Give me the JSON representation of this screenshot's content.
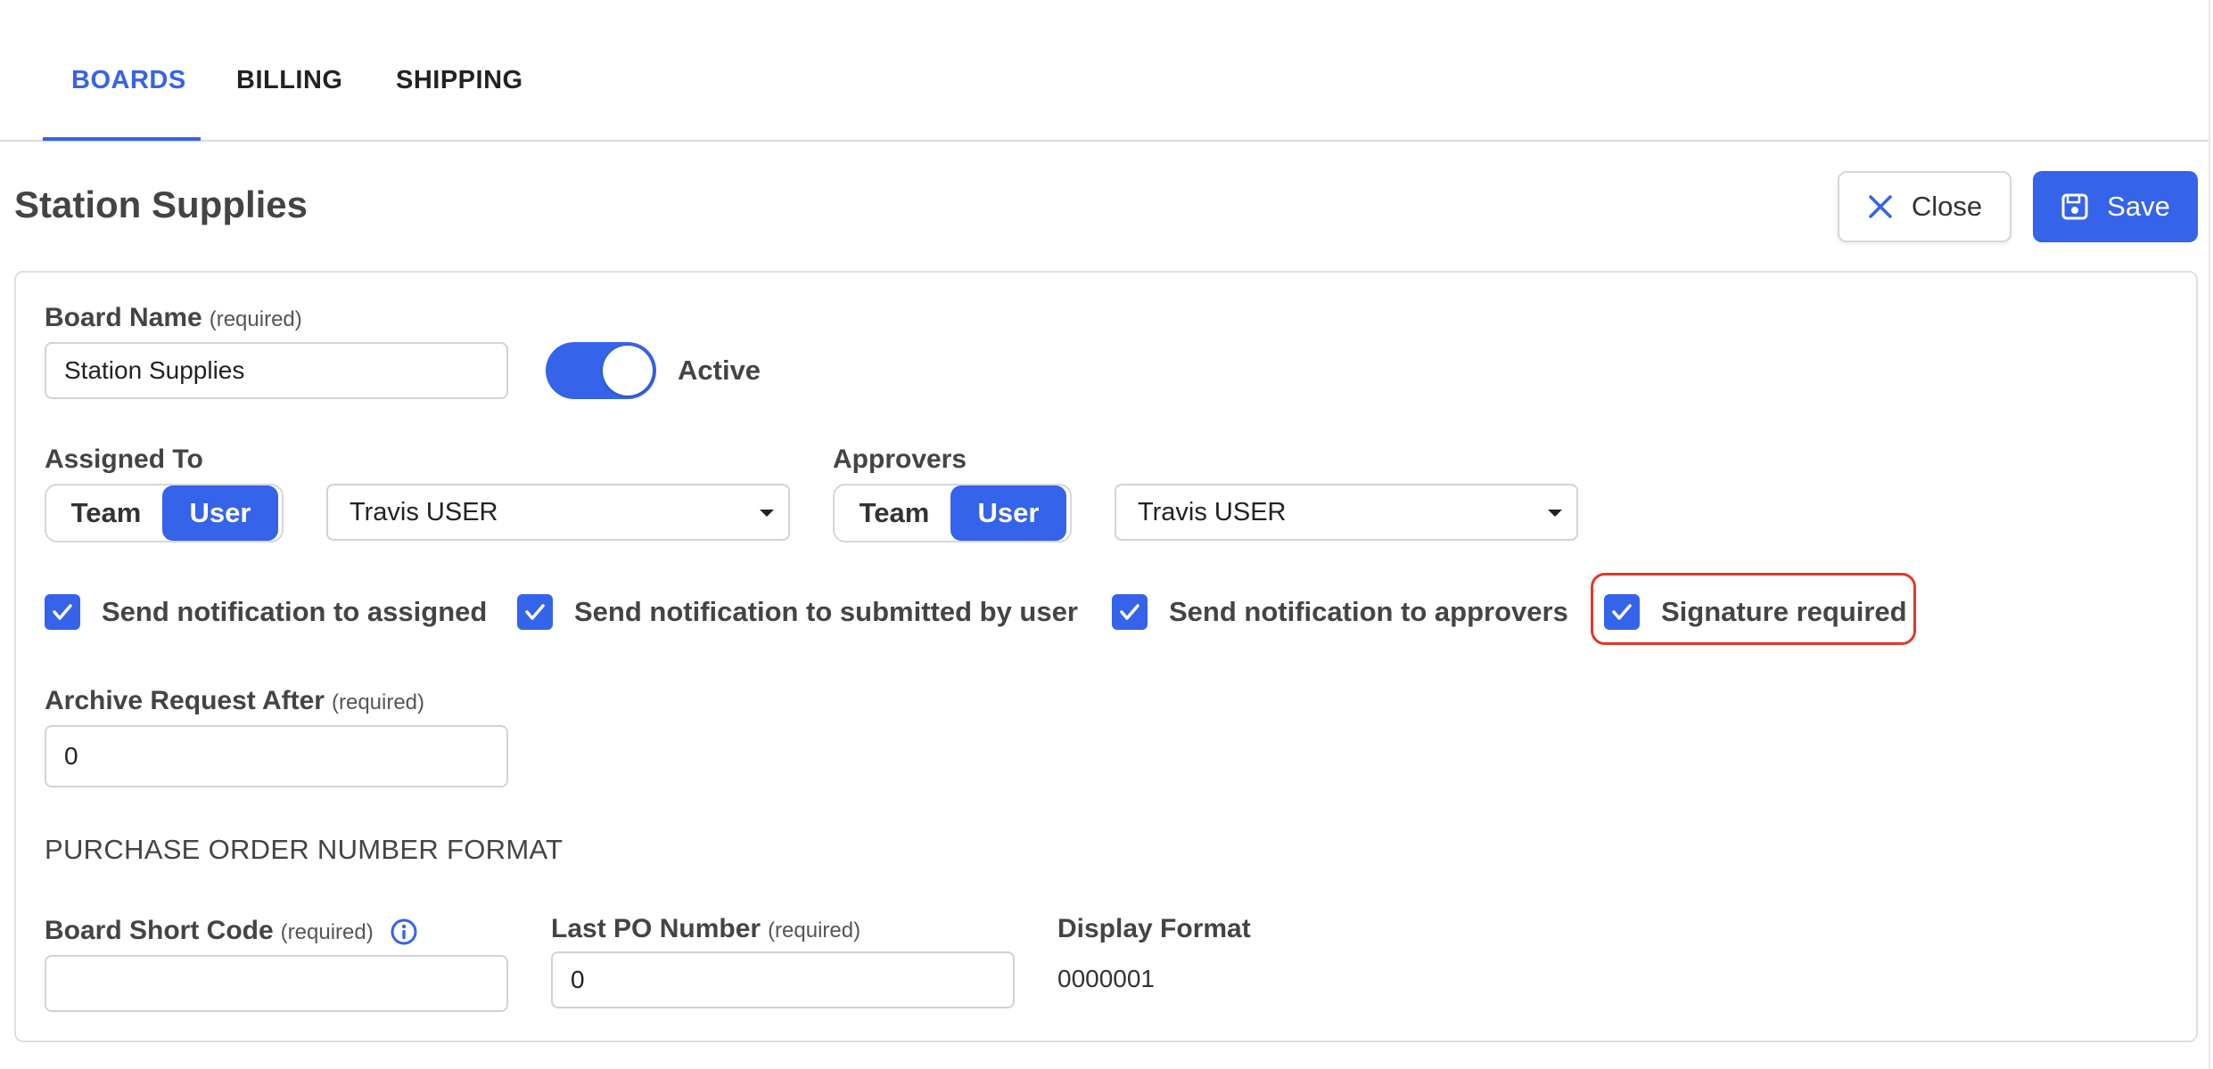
{
  "tabs": [
    {
      "label": "BOARDS",
      "active": true
    },
    {
      "label": "BILLING",
      "active": false
    },
    {
      "label": "SHIPPING",
      "active": false
    }
  ],
  "header": {
    "title": "Station Supplies",
    "close_label": "Close",
    "save_label": "Save"
  },
  "form": {
    "board_name": {
      "label": "Board Name",
      "required_note": "(required)",
      "value": "Station Supplies"
    },
    "active": {
      "label": "Active",
      "on": true
    },
    "assigned_to": {
      "label": "Assigned To",
      "team_label": "Team",
      "user_label": "User",
      "selected_mode": "User",
      "selected_value": "Travis USER"
    },
    "approvers": {
      "label": "Approvers",
      "team_label": "Team",
      "user_label": "User",
      "selected_mode": "User",
      "selected_value": "Travis USER"
    },
    "checkboxes": [
      {
        "label": "Send notification to assigned",
        "checked": true
      },
      {
        "label": "Send notification to submitted by user",
        "checked": true
      },
      {
        "label": "Send notification to approvers",
        "checked": true
      },
      {
        "label": "Signature required",
        "checked": true
      }
    ],
    "archive_after": {
      "label": "Archive Request After",
      "required_note": "(required)",
      "value": "0"
    },
    "po_section_heading": "PURCHASE ORDER NUMBER FORMAT",
    "board_short_code": {
      "label": "Board Short Code",
      "required_note": "(required)",
      "value": ""
    },
    "last_po_number": {
      "label": "Last PO Number",
      "required_note": "(required)",
      "value": "0"
    },
    "display_format": {
      "label": "Display Format",
      "value": "0000001"
    }
  },
  "colors": {
    "accent": "#3563e9",
    "highlight": "#e0392b"
  },
  "icons": {
    "close": "close-icon",
    "save": "save-icon",
    "check": "check-icon",
    "info": "info-icon",
    "dropdown": "caret-down-icon"
  }
}
